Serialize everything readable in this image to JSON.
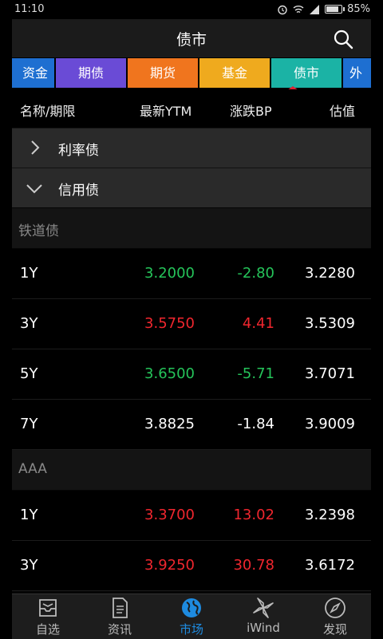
{
  "status_bar": {
    "time": "11:10",
    "battery": "85%"
  },
  "header": {
    "title": "债市"
  },
  "tabs": [
    {
      "label": "资金",
      "color": "#1e6fd1"
    },
    {
      "label": "期债",
      "color": "#6a4bd6"
    },
    {
      "label": "期货",
      "color": "#f0751e"
    },
    {
      "label": "基金",
      "color": "#efaa1e"
    },
    {
      "label": "债市",
      "color": "#1bb3a5",
      "active": true
    },
    {
      "label": "外",
      "color": "#1e6fd1"
    }
  ],
  "columns": {
    "name": "名称/期限",
    "ytm": "最新YTM",
    "bp": "涨跌BP",
    "valuation": "估值"
  },
  "groups": [
    {
      "label": "利率债",
      "expanded": false
    },
    {
      "label": "信用债",
      "expanded": true
    }
  ],
  "sections": [
    {
      "title": "铁道债",
      "rows": [
        {
          "term": "1Y",
          "ytm": "3.2000",
          "bp": "-2.80",
          "val": "3.2280",
          "trend": "down"
        },
        {
          "term": "3Y",
          "ytm": "3.5750",
          "bp": "4.41",
          "val": "3.5309",
          "trend": "up"
        },
        {
          "term": "5Y",
          "ytm": "3.6500",
          "bp": "-5.71",
          "val": "3.7071",
          "trend": "down"
        },
        {
          "term": "7Y",
          "ytm": "3.8825",
          "bp": "-1.84",
          "val": "3.9009",
          "trend": "flat"
        }
      ]
    },
    {
      "title": "AAA",
      "rows": [
        {
          "term": "1Y",
          "ytm": "3.3700",
          "bp": "13.02",
          "val": "3.2398",
          "trend": "up"
        },
        {
          "term": "3Y",
          "ytm": "3.9250",
          "bp": "30.78",
          "val": "3.6172",
          "trend": "up"
        }
      ]
    }
  ],
  "bottom_nav": [
    {
      "label": "自选",
      "icon": "inbox-icon"
    },
    {
      "label": "资讯",
      "icon": "document-icon"
    },
    {
      "label": "市场",
      "icon": "globe-icon",
      "active": true
    },
    {
      "label": "iWind",
      "icon": "pinwheel-icon"
    },
    {
      "label": "发现",
      "icon": "compass-icon"
    }
  ],
  "colors": {
    "up": "#f0262e",
    "down": "#25c45a",
    "accent": "#1e8be0"
  }
}
